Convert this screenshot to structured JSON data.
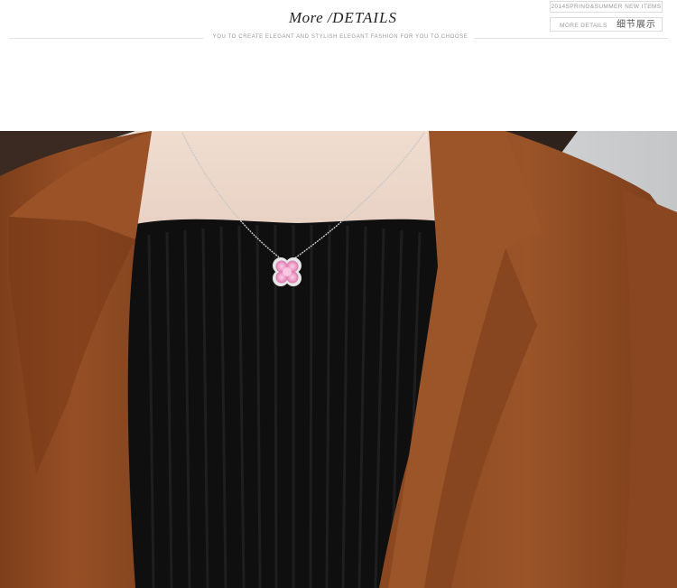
{
  "header": {
    "title_more": "More",
    "title_sep": "/",
    "title_details": "DETAILS",
    "subtitle": "YOU TO CREATE ELEGANT AND STYLISH ELEGANT FASHION FOR YOU TO CHOOSE",
    "tag_top": "2014SPRING&SUMMER NEW ITEMS",
    "tag_bottom_en": "MORE DETAILS",
    "tag_bottom_cn": "细节展示"
  },
  "photo": {
    "colors": {
      "jacket": "#8b4a22",
      "jacket_shadow": "#6b3515",
      "sweater": "#0d0d0d",
      "skin": "#ecd9cc",
      "background": "#d2d2d2",
      "pendant_gem": "#f2b6d6"
    }
  }
}
